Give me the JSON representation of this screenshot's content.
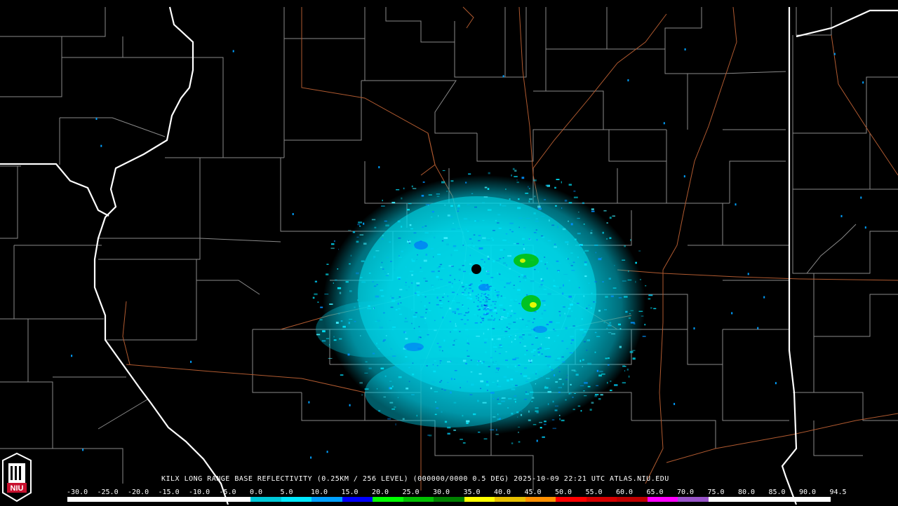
{
  "product": {
    "caption": "KILX LONG RANGE BASE REFLECTIVITY (0.25KM / 256 LEVEL) (000000/0000 0.5 DEG) 2025-10-09 22:21 UTC  ATLAS.NIU.EDU"
  },
  "colorbar": {
    "ticks": [
      "-30.0",
      "-25.0",
      "-20.0",
      "-15.0",
      "-10.0",
      "-5.0",
      "0.0",
      "5.0",
      "10.0",
      "15.0",
      "20.0",
      "25.0",
      "30.0",
      "35.0",
      "40.0",
      "45.0",
      "50.0",
      "55.0",
      "60.0",
      "65.0",
      "70.0",
      "75.0",
      "80.0",
      "85.0",
      "90.0",
      "94.5"
    ],
    "colors": [
      "#ffffff",
      "#ffffff",
      "#ffffff",
      "#ffffff",
      "#ffffff",
      "#ffffff",
      "#00c8d8",
      "#00e8ff",
      "#00a0ff",
      "#0000ff",
      "#00ff00",
      "#00c000",
      "#008000",
      "#ffff00",
      "#e7c000",
      "#ff9000",
      "#ff0000",
      "#d60000",
      "#c00000",
      "#ff00ff",
      "#9955c9",
      "#ffffff",
      "#ffffff",
      "#ffffff",
      "#ffffff"
    ]
  },
  "logo": {
    "text": "NIU",
    "colors": {
      "red": "#c8102e",
      "white": "#ffffff"
    }
  },
  "map": {
    "radar_site": "KILX",
    "background": "#000000",
    "colors": {
      "county": "#8a8a8a",
      "state": "#ffffff",
      "road": "#b05a30",
      "echo_low": "#00e0f0",
      "echo_mid": "#0080ff",
      "echo_high": "#00c000"
    }
  }
}
